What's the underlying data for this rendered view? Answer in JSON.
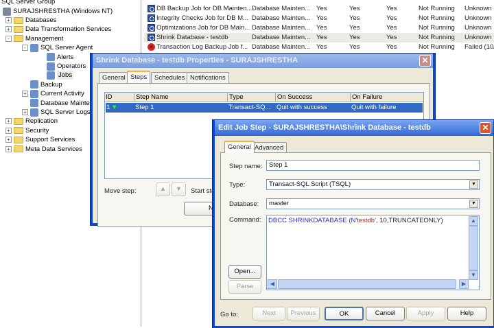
{
  "tree": {
    "group": "SQL Server Group",
    "server": "SURAJSHRESTHA (Windows NT)",
    "items": [
      {
        "label": "Databases",
        "level": 1,
        "expand": "+"
      },
      {
        "label": "Data Transformation Services",
        "level": 1,
        "expand": "+"
      },
      {
        "label": "Management",
        "level": 1,
        "expand": "-"
      },
      {
        "label": "SQL Server Agent",
        "level": 2,
        "expand": "-"
      },
      {
        "label": "Alerts",
        "level": 3
      },
      {
        "label": "Operators",
        "level": 3
      },
      {
        "label": "Jobs",
        "level": 3,
        "selected": true
      },
      {
        "label": "Backup",
        "level": 2
      },
      {
        "label": "Current Activity",
        "level": 2,
        "expand": "+"
      },
      {
        "label": "Database Maintena",
        "level": 2
      },
      {
        "label": "SQL Server Logs",
        "level": 2,
        "expand": "+"
      },
      {
        "label": "Replication",
        "level": 1,
        "expand": "+"
      },
      {
        "label": "Security",
        "level": 1,
        "expand": "+"
      },
      {
        "label": "Support Services",
        "level": 1,
        "expand": "+"
      },
      {
        "label": "Meta Data Services",
        "level": 1,
        "expand": "+"
      }
    ]
  },
  "jobs": [
    {
      "name": "DB Backup Job for DB Mainten...",
      "category": "Database Mainten...",
      "enabled": "Yes",
      "runnable": "Yes",
      "scheduled": "Yes",
      "status": "Not Running",
      "last": "Unknown",
      "icon": "job-icon"
    },
    {
      "name": "Integrity Checks Job for DB M...",
      "category": "Database Mainten...",
      "enabled": "Yes",
      "runnable": "Yes",
      "scheduled": "Yes",
      "status": "Not Running",
      "last": "Unknown",
      "icon": "job-icon"
    },
    {
      "name": "Optimizations Job for DB Main...",
      "category": "Database Mainten...",
      "enabled": "Yes",
      "runnable": "Yes",
      "scheduled": "Yes",
      "status": "Not Running",
      "last": "Unknown",
      "icon": "job-icon"
    },
    {
      "name": "Shrink Database - testdb",
      "category": "Database Mainten...",
      "enabled": "Yes",
      "runnable": "Yes",
      "scheduled": "Yes",
      "status": "Not Running",
      "last": "Unknown",
      "icon": "job-icon"
    },
    {
      "name": "Transaction Log Backup Job f...",
      "category": "Database Mainten...",
      "enabled": "Yes",
      "runnable": "Yes",
      "scheduled": "Yes",
      "status": "Not Running",
      "last": "Failed (10/",
      "icon": "failed-icon"
    }
  ],
  "props": {
    "title": "Shrink Database - testdb Properties - SURAJSHRESTHA",
    "close": "✕",
    "tabs": [
      "General",
      "Steps",
      "Schedules",
      "Notifications"
    ],
    "columns": [
      "ID",
      "Step Name",
      "Type",
      "On Success",
      "On Failure"
    ],
    "rows": [
      {
        "id": "1",
        "name": "Step 1",
        "type": "Transact-SQ...",
        "success": "Quit with success",
        "failure": "Quit with failure"
      }
    ],
    "move_step": "Move step:",
    "start_step": "Start step",
    "new": "New"
  },
  "edit": {
    "title": "Edit Job Step - SURAJSHRESTHA\\Shrink Database - testdb",
    "close": "✕",
    "tabs": [
      "General",
      "Advanced"
    ],
    "step_name_label": "Step name:",
    "step_name": "Step 1",
    "type_label": "Type:",
    "type": "Transact-SQL Script (TSQL)",
    "database_label": "Database:",
    "database": "master",
    "command_label": "Command:",
    "command": {
      "kw": "DBCC SHRINKDATABASE (N",
      "str": "'testdb'",
      "rest": ", 10,TRUNCATEONLY)"
    },
    "open": "Open...",
    "parse": "Parse",
    "goto": "Go to:",
    "buttons": {
      "next": "Next",
      "previous": "Previous",
      "ok": "OK",
      "cancel": "Cancel",
      "apply": "Apply",
      "help": "Help"
    }
  },
  "colors": {
    "keyword": "#2b2bb5",
    "string": "#d01010",
    "selection": "#316ac5",
    "titlebar": "#0a47d6"
  }
}
